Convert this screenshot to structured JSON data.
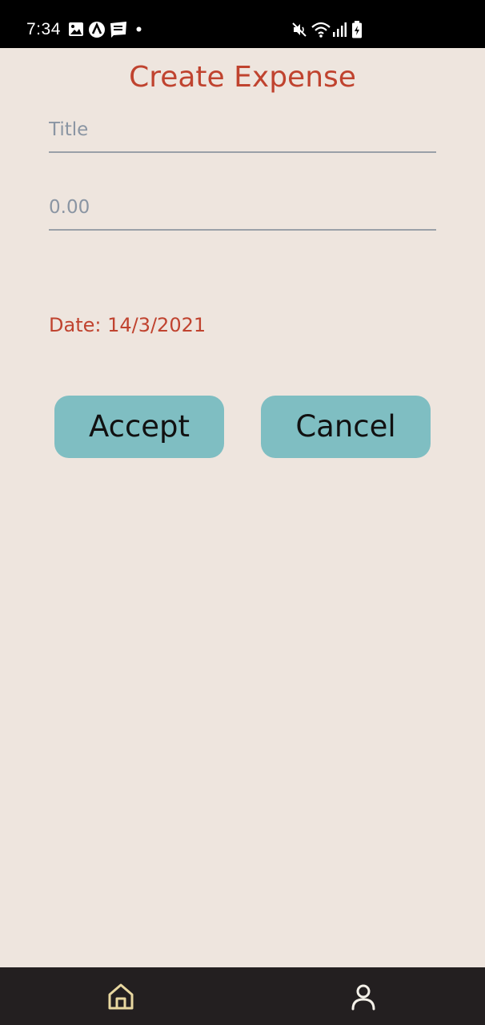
{
  "status_bar": {
    "time": "7:34",
    "left_icons": [
      "image-icon",
      "arc-app-icon",
      "webtoon-icon",
      "dot-icon"
    ],
    "right_icons": [
      "mute-icon",
      "wifi-icon",
      "signal-icon",
      "battery-charging-icon"
    ]
  },
  "form": {
    "title": "Create Expense",
    "title_placeholder": "Title",
    "amount_placeholder": "0.00",
    "date_label": "Date: 14/3/2021"
  },
  "actions": {
    "accept_label": "Accept",
    "cancel_label": "Cancel"
  },
  "bottom_nav": {
    "items": [
      {
        "icon": "home-icon",
        "active": true
      },
      {
        "icon": "profile-icon",
        "active": false
      }
    ]
  },
  "colors": {
    "background": "#EEE5DE",
    "accent_red": "#C0432F",
    "button_teal": "#7FBEC2",
    "nav_bar": "#231F20",
    "home_icon_active": "#E8D7A0",
    "profile_icon": "#F3F0E8"
  }
}
